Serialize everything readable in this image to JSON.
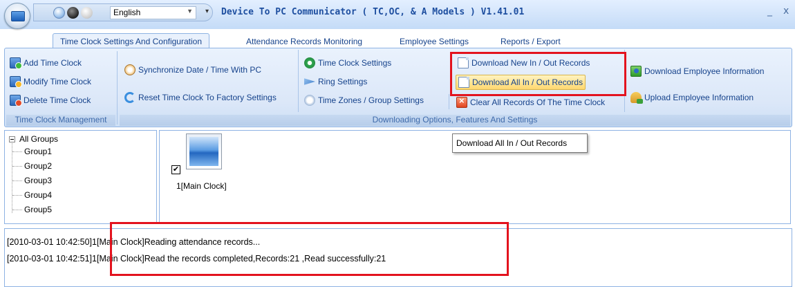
{
  "window": {
    "title": "Device To PC Communicator ( TC,OC, & A Models ) V1.41.01",
    "minimize_glyph": "_",
    "close_glyph": "x"
  },
  "quick_access": {
    "language": "English",
    "customize_glyph": "▾"
  },
  "tabs": [
    {
      "label": "Time Clock Settings And Configuration",
      "active": true
    },
    {
      "label": "Attendance Records Monitoring",
      "active": false
    },
    {
      "label": "Employee Settings",
      "active": false
    },
    {
      "label": "Reports / Export",
      "active": false
    }
  ],
  "ribbon": {
    "management": {
      "label": "Time Clock Management",
      "add": "Add Time Clock",
      "modify": "Modify Time Clock",
      "delete": "Delete Time Clock"
    },
    "options": {
      "label": "Downloading Options, Features And Settings",
      "sync": "Synchronize Date / Time With PC",
      "reset": "Reset Time Clock To Factory Settings",
      "settings": "Time Clock Settings",
      "ring": "Ring Settings",
      "timezones": "Time Zones / Group Settings",
      "download_new": "Download New In / Out Records",
      "download_all": "Download All In / Out Records",
      "clear": "Clear All Records Of The Time Clock",
      "download_employee": "Download Employee Information",
      "upload_employee": "Upload Employee Information"
    }
  },
  "tooltip": "Download All In / Out Records",
  "tree": {
    "root": "All Groups",
    "groups": [
      "Group1",
      "Group2",
      "Group3",
      "Group4",
      "Group5"
    ]
  },
  "device": {
    "label": "1[Main Clock]",
    "checked": "✔"
  },
  "log": [
    "[2010-03-01 10:42:50]1[Main Clock]Reading attendance records...",
    "[2010-03-01 10:42:51]1[Main Clock]Read the records completed,Records:21 ,Read successfully:21"
  ],
  "colors": {
    "highlight_box": "#e3131e",
    "ribbon_text": "#15428b"
  }
}
